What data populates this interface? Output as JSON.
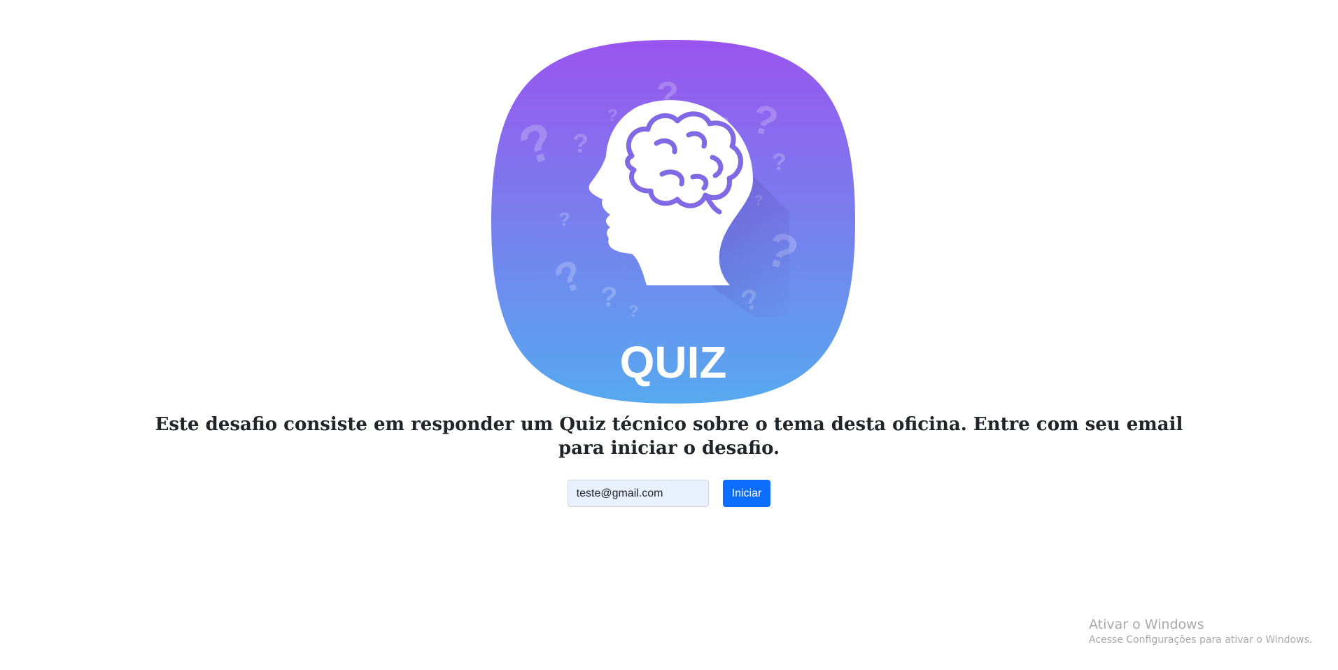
{
  "logo": {
    "text": "QUIZ",
    "icon": "brain-head-icon",
    "gradient_top": "#9a55ee",
    "gradient_bottom": "#56a9ef"
  },
  "intro": {
    "text": "Este desafio consiste em responder um Quiz técnico sobre o tema desta oficina. Entre com seu email para iniciar o desafio."
  },
  "form": {
    "email_value": "teste@gmail.com",
    "submit_label": "Iniciar",
    "accent": "#0d6efd"
  },
  "windows_activation": {
    "title": "Ativar o Windows",
    "subtitle": "Acesse Configurações para ativar o Windows."
  }
}
